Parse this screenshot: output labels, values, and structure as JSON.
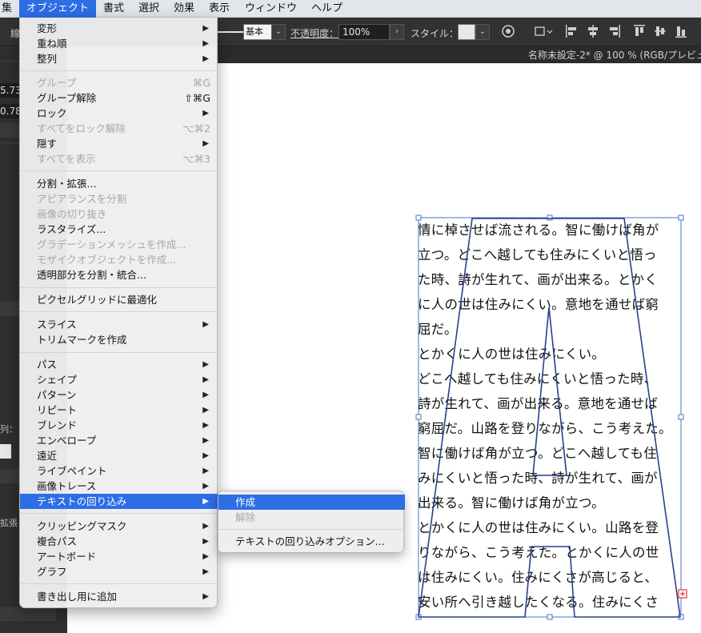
{
  "menubar": {
    "items": [
      "集",
      "オブジェクト",
      "書式",
      "選択",
      "効果",
      "表示",
      "ウィンドウ",
      "ヘルプ"
    ]
  },
  "controlbar": {
    "stroke_label": "基本",
    "opacity_label": "不透明度：",
    "opacity_value": "100%",
    "style_label": "スタイル：",
    "left_partial": "線"
  },
  "document": {
    "tab_title": "名称未設定-2* @ 100 % (RGB/プレビュ"
  },
  "leftpanel": {
    "val1": "5.73",
    "val2": "0.780",
    "label_retsu": "列：",
    "label_kakucho": "拡張"
  },
  "object_menu": {
    "items": [
      {
        "label": "変形",
        "submenu": true,
        "enabled": true
      },
      {
        "label": "重ね順",
        "submenu": true,
        "enabled": true
      },
      {
        "label": "整列",
        "submenu": true,
        "enabled": true
      },
      {
        "label": "グループ",
        "shortcut": "⌘G",
        "enabled": false
      },
      {
        "label": "グループ解除",
        "shortcut": "⇧⌘G",
        "enabled": true
      },
      {
        "label": "ロック",
        "submenu": true,
        "enabled": true
      },
      {
        "label": "すべてをロック解除",
        "shortcut": "⌥⌘2",
        "enabled": false
      },
      {
        "label": "隠す",
        "submenu": true,
        "enabled": true
      },
      {
        "label": "すべてを表示",
        "shortcut": "⌥⌘3",
        "enabled": false
      },
      {
        "label": "分割・拡張...",
        "enabled": true
      },
      {
        "label": "アピアランスを分割",
        "enabled": false
      },
      {
        "label": "画像の切り抜き",
        "enabled": false
      },
      {
        "label": "ラスタライズ...",
        "enabled": true
      },
      {
        "label": "グラデーションメッシュを作成...",
        "enabled": false
      },
      {
        "label": "モザイクオブジェクトを作成...",
        "enabled": false
      },
      {
        "label": "透明部分を分割・統合...",
        "enabled": true
      },
      {
        "label": "ピクセルグリッドに最適化",
        "enabled": true
      },
      {
        "label": "スライス",
        "submenu": true,
        "enabled": true
      },
      {
        "label": "トリムマークを作成",
        "enabled": true
      },
      {
        "label": "パス",
        "submenu": true,
        "enabled": true
      },
      {
        "label": "シェイプ",
        "submenu": true,
        "enabled": true
      },
      {
        "label": "パターン",
        "submenu": true,
        "enabled": true
      },
      {
        "label": "リピート",
        "submenu": true,
        "enabled": true
      },
      {
        "label": "ブレンド",
        "submenu": true,
        "enabled": true
      },
      {
        "label": "エンベロープ",
        "submenu": true,
        "enabled": true
      },
      {
        "label": "遠近",
        "submenu": true,
        "enabled": true
      },
      {
        "label": "ライブペイント",
        "submenu": true,
        "enabled": true
      },
      {
        "label": "画像トレース",
        "submenu": true,
        "enabled": true
      },
      {
        "label": "テキストの回り込み",
        "submenu": true,
        "enabled": true,
        "highlighted": true
      },
      {
        "label": "クリッピングマスク",
        "submenu": true,
        "enabled": true
      },
      {
        "label": "複合パス",
        "submenu": true,
        "enabled": true
      },
      {
        "label": "アートボード",
        "submenu": true,
        "enabled": true
      },
      {
        "label": "グラフ",
        "submenu": true,
        "enabled": true
      },
      {
        "label": "書き出し用に追加",
        "submenu": true,
        "enabled": true
      }
    ]
  },
  "text_wrap_submenu": {
    "items": [
      {
        "label": "作成",
        "enabled": true,
        "highlighted": true
      },
      {
        "label": "解除",
        "enabled": false
      },
      {
        "label": "テキストの回り込みオプション...",
        "enabled": true
      }
    ]
  },
  "canvas_text": {
    "lines": [
      "情に棹させば流される。智に働けば角が",
      "立つ。どこへ越しても住みにくいと悟っ",
      "た時、詩が生れて、画が出来る。とかく",
      "に人の世は住みにくい。意地を通せば窮",
      "屈だ。",
      "とかくに人の世は住みにくい。",
      "どこへ越しても住みにくいと悟った時、",
      "詩が生れて、画が出来る。意地を通せば",
      "窮屈だ。山路を登りながら、こう考えた。",
      "智に働けば角が立つ。どこへ越しても住",
      "みにくいと悟った時、詩が生れて、画が",
      "出来る。智に働けば角が立つ。",
      "とかくに人の世は住みにくい。山路を登",
      "りながら、こう考えた。とかくに人の世",
      "は住みにくい。住みにくさが高じると、",
      "安い所へ引き越したくなる。住みにくさ"
    ]
  },
  "colors": {
    "menubar_bg": "#e2e5ea",
    "highlight": "#2c6ee6",
    "selection": "#4a74c9",
    "shape_stroke": "#2a3f8f",
    "overflow_marker": "#e03a3a"
  }
}
